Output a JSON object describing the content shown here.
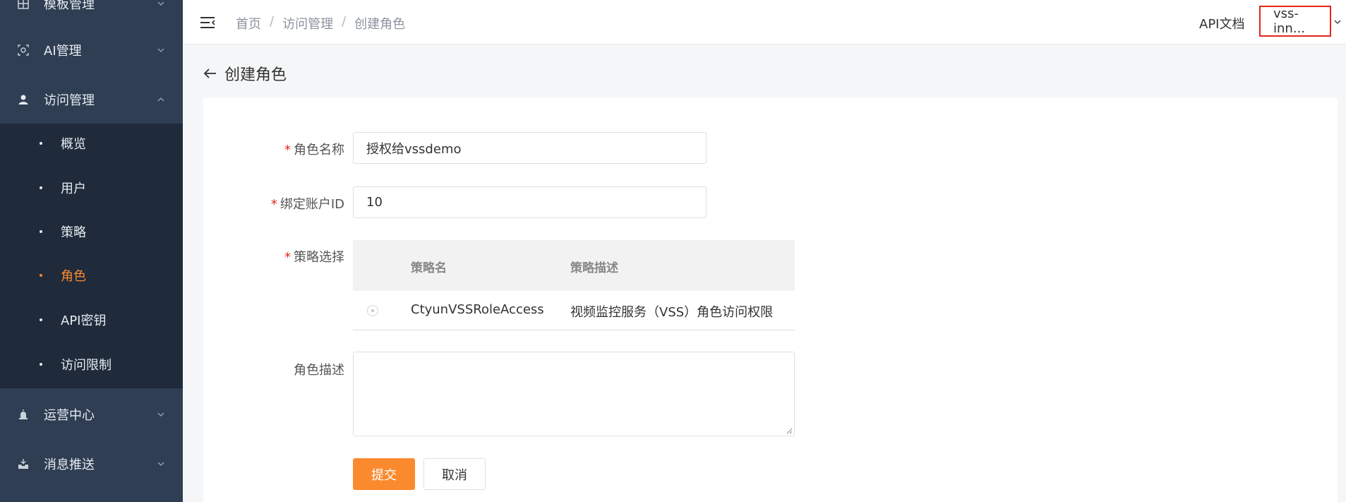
{
  "sidebar": {
    "menu": [
      {
        "label": "模板管理",
        "icon": "grid-icon"
      },
      {
        "label": "AI管理",
        "icon": "ai-camera-icon"
      },
      {
        "label": "访问管理",
        "icon": "user-icon"
      },
      {
        "label": "运营中心",
        "icon": "alarm-icon"
      },
      {
        "label": "消息推送",
        "icon": "inbox-icon"
      }
    ],
    "submenu": [
      {
        "label": "概览"
      },
      {
        "label": "用户"
      },
      {
        "label": "策略"
      },
      {
        "label": "角色",
        "active": true
      },
      {
        "label": "API密钥"
      },
      {
        "label": "访问限制"
      }
    ]
  },
  "header": {
    "breadcrumb": [
      "首页",
      "访问管理",
      "创建角色"
    ],
    "api_doc": "API文档",
    "user": "vss-inn..."
  },
  "page": {
    "title": "创建角色"
  },
  "form": {
    "role_name_label": "角色名称",
    "role_name_value": "授权给vssdemo",
    "account_id_label": "绑定账户ID",
    "account_id_value": "10",
    "policy_label": "策略选择",
    "policy_table": {
      "headers": [
        "策略名",
        "策略描述"
      ],
      "rows": [
        {
          "name": "CtyunVSSRoleAccess",
          "desc": "视频监控服务（VSS）角色访问权限"
        }
      ]
    },
    "desc_label": "角色描述",
    "required_mark": "*",
    "submit": "提交",
    "cancel": "取消"
  },
  "colors": {
    "accent": "#fb8a2e",
    "sidebar_bg": "#2f3e52",
    "submenu_bg": "#1f2a3a",
    "highlight_border": "#e3271c"
  }
}
